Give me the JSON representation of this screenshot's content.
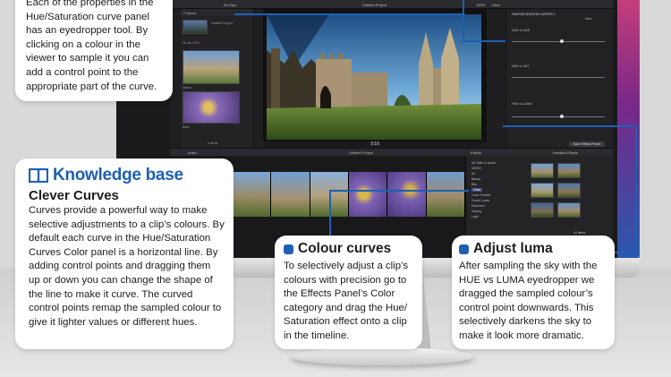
{
  "app": {
    "project_title": "Untitled Project",
    "browser_header": "Projects",
    "browser_filter": "All Clips",
    "date_label": "26 Jun 2021",
    "viewer_zoom": "100%",
    "viewer_view": "View",
    "timecode": "3:16",
    "inspector_effect": "HUE/SATURATION CURVES 1",
    "inspector_view": "View",
    "curve_labels": [
      "HUE vs HUE",
      "HUE vs SAT",
      "HUE vs LUMA"
    ],
    "save_preset": "Save Effects Preset",
    "timeline_index": "Index",
    "timeline_project": "Untitled Project",
    "effects_header": "Effects",
    "effects_installed": "Installed Effects",
    "effects_categories": [
      "All Video & Audio",
      "VIDEO",
      "All",
      "Basics",
      "Blur",
      "Color",
      "Color Presets",
      "Comic Looks",
      "Distortion",
      "Keying",
      "Light"
    ],
    "effects_items": "44 items",
    "browser_items": "3 items",
    "clip_labels": [
      "Untitled Project",
      "Abbey",
      "Bees"
    ]
  },
  "boxes": {
    "top": {
      "text": "Each of the properties in the Hue/Saturation curve panel has an eyedropper tool. By clicking on a colour in the viewer to sample it you can add a control point to the appropriate part of the curve."
    },
    "knowledge": {
      "title": "Knowledge base",
      "subtitle": "Clever Curves",
      "text": "Curves provide a powerful way to make selective adjustments to a clip’s colours. By default each curve in the Hue/Saturation Curves Color panel is a horizontal line. By adding control points and dragging them up or down you can change the shape of the line to make it curve. The curved control points remap the sampled colour to give it lighter values or different hues."
    },
    "colour_curves": {
      "title": "Colour curves",
      "text": "To selectively adjust a clip’s colours with precision go to the Effects Panel’s Color category and drag the Hue/ Saturation effect onto a clip in the timeline."
    },
    "adjust_luma": {
      "title": "Adjust luma",
      "text": "After sampling the sky with the HUE vs LUMA eyedropper we dragged the sampled colour’s control point downwards. This selectively darkens the sky to make it look more dramatic."
    }
  },
  "colors": {
    "accent": "#1e5fb4",
    "panel": "#1f1f22",
    "box": "#ffffff"
  }
}
